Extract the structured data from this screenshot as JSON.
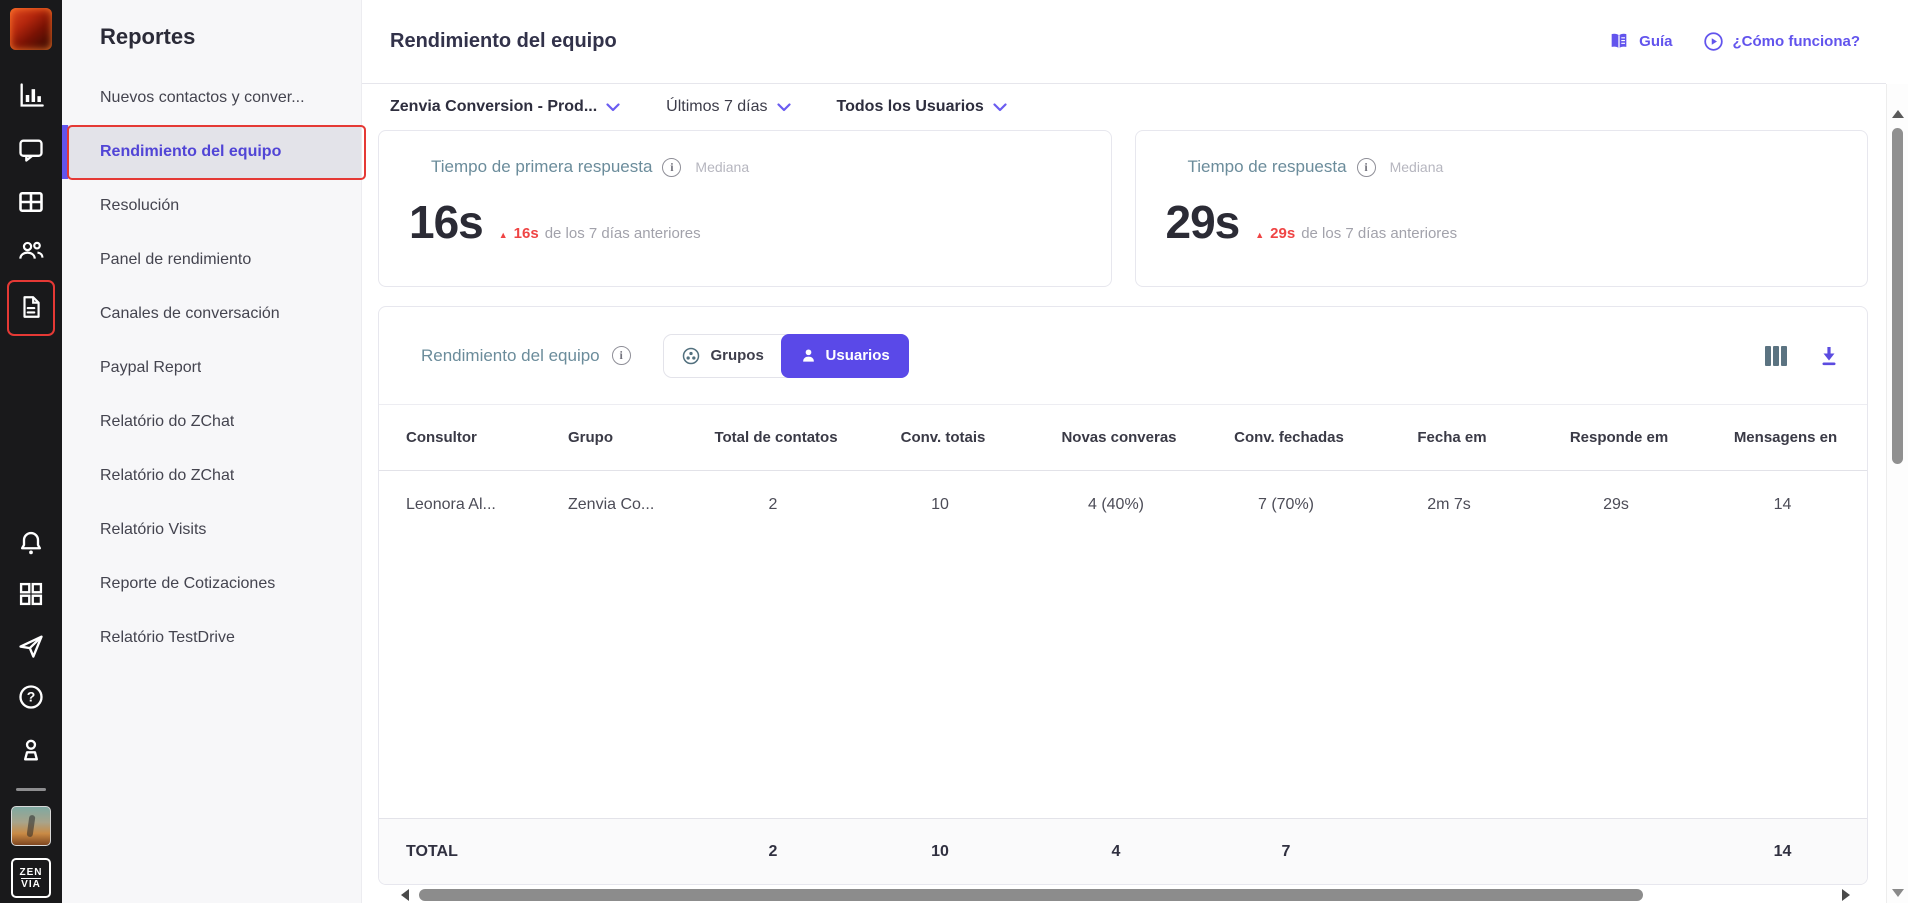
{
  "app": {
    "accent": "#5a49e8",
    "link_purple": "#6254ed",
    "annotation_red": "#e53935",
    "delta_red": "#ef4444"
  },
  "rail": {
    "icons": [
      "app-logo",
      "bar-chart",
      "chat",
      "table",
      "team",
      "document",
      "bell",
      "apps",
      "send",
      "help",
      "profile",
      "user-avatar",
      "zenvia-logo"
    ]
  },
  "sidebar": {
    "title": "Reportes",
    "items": [
      {
        "label": "Nuevos contactos y conver...",
        "selected": false
      },
      {
        "label": "Rendimiento del equipo",
        "selected": true
      },
      {
        "label": "Resolución",
        "selected": false
      },
      {
        "label": "Panel de rendimiento",
        "selected": false
      },
      {
        "label": "Canales de conversación",
        "selected": false
      },
      {
        "label": "Paypal Report",
        "selected": false
      },
      {
        "label": "Relatório do ZChat",
        "selected": false
      },
      {
        "label": "Relatório do ZChat",
        "selected": false
      },
      {
        "label": "Relatório Visits",
        "selected": false
      },
      {
        "label": "Reporte de Cotizaciones",
        "selected": false
      },
      {
        "label": "Relatório TestDrive",
        "selected": false
      }
    ]
  },
  "header": {
    "title": "Rendimiento del equipo",
    "guide_label": "Guía",
    "how_label": "¿Cómo funciona?"
  },
  "filters": {
    "account": "Zenvia Conversion - Prod...",
    "period": "Últimos 7 días",
    "users": "Todos los Usuarios"
  },
  "cards": [
    {
      "title": "Tiempo de primera respuesta",
      "qualifier": "Mediana",
      "value": "16s",
      "delta": "16s",
      "delta_note": "de los 7 días anteriores"
    },
    {
      "title": "Tiempo de respuesta",
      "qualifier": "Mediana",
      "value": "29s",
      "delta": "29s",
      "delta_note": "de los 7 días anteriores"
    }
  ],
  "panel": {
    "title": "Rendimiento del equipo",
    "toggle": {
      "groups": "Grupos",
      "users": "Usuarios",
      "selected": "Usuarios"
    },
    "table": {
      "columns": [
        "Consultor",
        "Grupo",
        "Total de contatos",
        "Conv. totais",
        "Novas converas",
        "Conv. fechadas",
        "Fecha em",
        "Responde em",
        "Mensagens en"
      ],
      "rows": [
        [
          "Leonora Al...",
          "Zenvia Co...",
          "2",
          "10",
          "4 (40%)",
          "7 (70%)",
          "2m 7s",
          "29s",
          "14"
        ]
      ],
      "total": [
        "TOTAL",
        "",
        "2",
        "10",
        "4",
        "7",
        "",
        "",
        "14"
      ]
    }
  }
}
